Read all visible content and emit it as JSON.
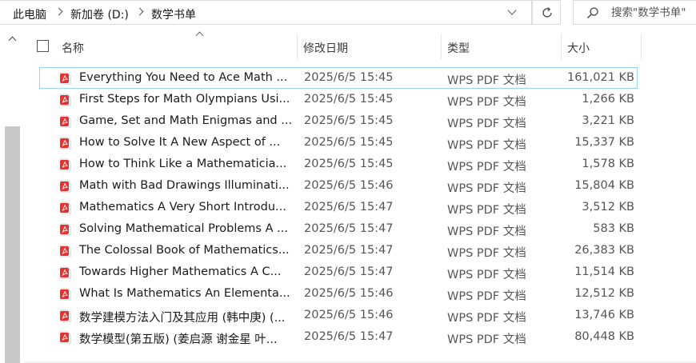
{
  "breadcrumb": {
    "items": [
      "此电脑",
      "新加卷 (D:)",
      "数学书单"
    ]
  },
  "search": {
    "placeholder": "搜索\"数学书单\""
  },
  "columns": {
    "name": "名称",
    "date": "修改日期",
    "type": "类型",
    "size": "大小"
  },
  "files": [
    {
      "name": "Everything You Need to Ace Math ...",
      "date": "2025/6/5 15:45",
      "type": "WPS PDF 文档",
      "size": "161,021 KB",
      "selected": true
    },
    {
      "name": "First Steps for Math Olympians Usi...",
      "date": "2025/6/5 15:45",
      "type": "WPS PDF 文档",
      "size": "1,266 KB"
    },
    {
      "name": "Game, Set and Math Enigmas and ...",
      "date": "2025/6/5 15:45",
      "type": "WPS PDF 文档",
      "size": "3,221 KB"
    },
    {
      "name": "How to Solve It A New Aspect of ...",
      "date": "2025/6/5 15:45",
      "type": "WPS PDF 文档",
      "size": "15,337 KB"
    },
    {
      "name": "How to Think Like a Mathematicia...",
      "date": "2025/6/5 15:45",
      "type": "WPS PDF 文档",
      "size": "1,578 KB"
    },
    {
      "name": "Math with Bad Drawings Illuminati...",
      "date": "2025/6/5 15:46",
      "type": "WPS PDF 文档",
      "size": "15,804 KB"
    },
    {
      "name": "Mathematics A Very Short Introdu...",
      "date": "2025/6/5 15:47",
      "type": "WPS PDF 文档",
      "size": "3,512 KB"
    },
    {
      "name": "Solving Mathematical Problems A ...",
      "date": "2025/6/5 15:47",
      "type": "WPS PDF 文档",
      "size": "583 KB"
    },
    {
      "name": "The Colossal Book of Mathematics...",
      "date": "2025/6/5 15:47",
      "type": "WPS PDF 文档",
      "size": "26,383 KB"
    },
    {
      "name": "Towards Higher Mathematics A C...",
      "date": "2025/6/5 15:47",
      "type": "WPS PDF 文档",
      "size": "11,514 KB"
    },
    {
      "name": "What Is Mathematics An Elementa...",
      "date": "2025/6/5 15:46",
      "type": "WPS PDF 文档",
      "size": "12,512 KB"
    },
    {
      "name": "数学建模方法入门及其应用 (韩中庚) (...",
      "date": "2025/6/5 15:46",
      "type": "WPS PDF 文档",
      "size": "13,746 KB"
    },
    {
      "name": "数学模型(第五版) (姜启源 谢金星 叶...",
      "date": "2025/6/5 15:47",
      "type": "WPS PDF 文档",
      "size": "80,448 KB"
    }
  ],
  "colors": {
    "pdf_icon": "#e8322f",
    "selection_border": "#99d1ff",
    "scroll_thumb": "#c8c8c8"
  },
  "icons": {
    "refresh": "refresh-icon",
    "search": "search-icon",
    "file": "pdf-file-icon"
  }
}
